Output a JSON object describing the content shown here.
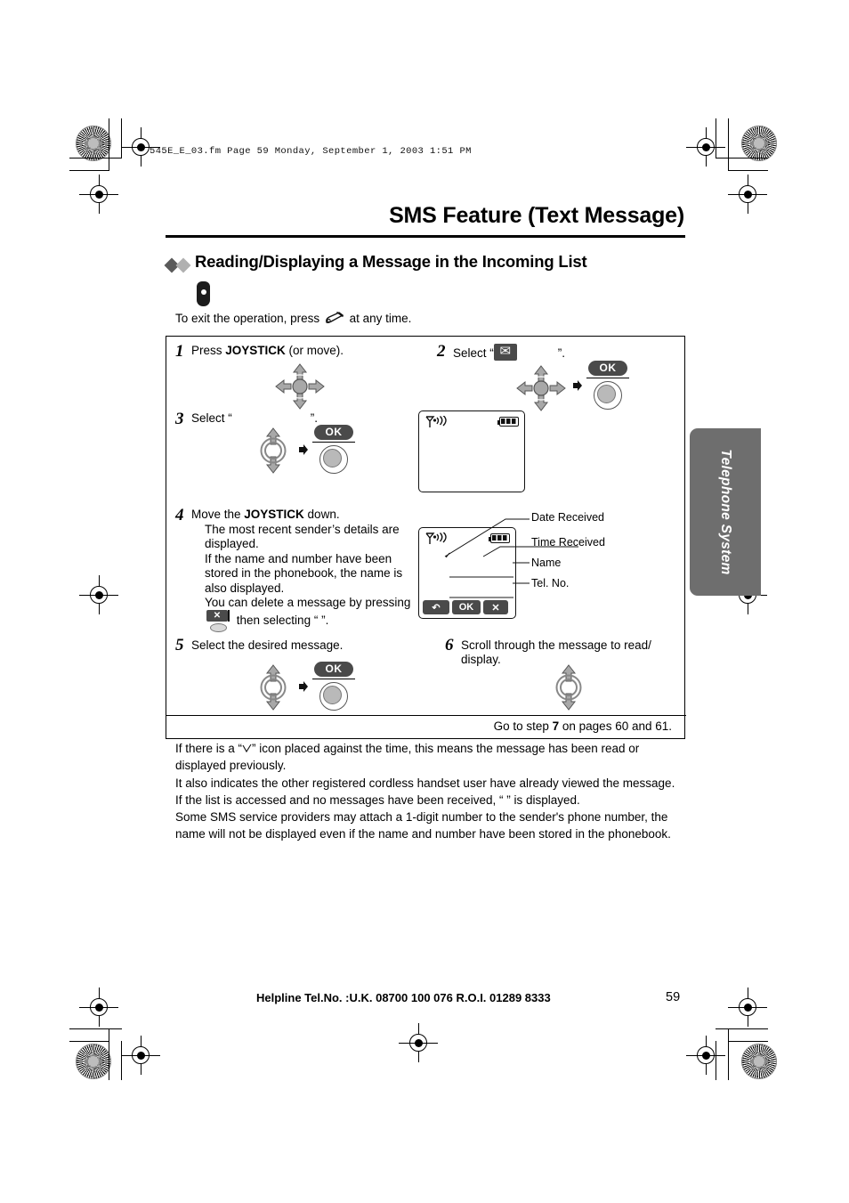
{
  "page": {
    "file_stamp": "545E_E_03.fm  Page 59  Monday, September 1, 2003  1:51 PM",
    "doc_title": "SMS Feature (Text Message)",
    "section_heading": "Reading/Displaying a Message in the Incoming List",
    "lead_in_before": "To exit the operation, press",
    "lead_in_after": "at any time.",
    "side_tab": "Telephone System",
    "footer": "Helpline Tel.No. :U.K. 08700 100 076  R.O.I. 01289 8333",
    "page_number": "59"
  },
  "steps": {
    "s1": {
      "num": "1",
      "text_before": "Press ",
      "bold": "JOYSTICK",
      "text_after": " (or move)."
    },
    "s2": {
      "num": "2",
      "text_before": "Select “",
      "text_after": "”."
    },
    "s3": {
      "num": "3",
      "text_before": "Select “",
      "text_after": "”."
    },
    "s4": {
      "num": "4",
      "line1_before": "Move the ",
      "line1_bold": "JOYSTICK",
      "line1_after": " down.",
      "body1": "The most recent sender’s details are displayed.",
      "body2": "If the name and number have been stored in the phonebook, the name is also displayed.",
      "body3_before": "You can delete a message by pressing",
      "body3_after": "then selecting “          ”."
    },
    "s5": {
      "num": "5",
      "text": "Select the desired message."
    },
    "s6": {
      "num": "6",
      "text": "Scroll through the message to read/ display."
    },
    "goto": {
      "before": "Go to step ",
      "bold": "7",
      "after": " on pages 60 and 61."
    }
  },
  "ok_button_label": "OK",
  "lcd": {
    "softkeys_detail": [
      "↺",
      "OK",
      "✕"
    ],
    "read_tick": "✓",
    "callouts": [
      "Date Received",
      "Time Received",
      "Name",
      "Tel. No."
    ]
  },
  "notes": {
    "n1_a": "If there is a “",
    "n1_b": "” icon placed against the time, this means the message has been read or displayed previously.",
    "n2": "It also indicates the other registered cordless handset user have already viewed the message.",
    "n3": "If the list is accessed and no messages have been received, “                                      ” is displayed.",
    "n4": "Some SMS service providers may attach a 1-digit number to the sender's phone number, the name will not be displayed even if the name and number have been stored in the phonebook."
  },
  "colors": {
    "tab_gray": "#6e6e6e",
    "key_gray": "#4a4a4a",
    "arrow_gray": "#a8a8a8",
    "diamond_dark": "#5a5a5a",
    "diamond_light": "#b0b0b0"
  },
  "icons": {
    "joystick_4way": "joystick-4way-icon",
    "joystick_updown": "joystick-updown-icon",
    "ok_key": "ok-key-icon",
    "envelope": "envelope-icon",
    "handset": "handset-icon",
    "off_key": "off-hook-key-icon",
    "delete_key": "delete-key-icon",
    "antenna": "antenna-signal-icon",
    "battery": "battery-icon"
  }
}
